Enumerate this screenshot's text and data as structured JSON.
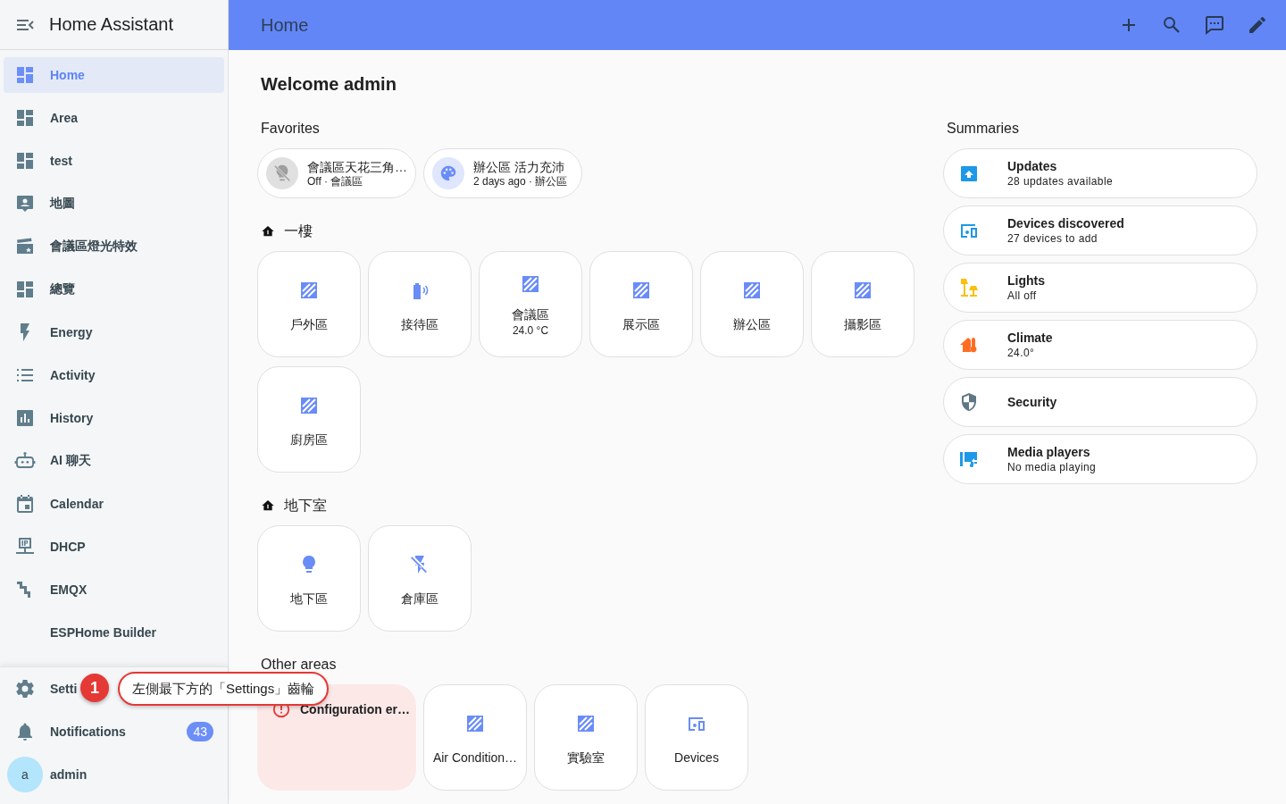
{
  "sidebar": {
    "title": "Home Assistant",
    "items": [
      {
        "label": "Home",
        "selected": true
      },
      {
        "label": "Area",
        "selected": false
      },
      {
        "label": "test",
        "selected": false
      },
      {
        "label": "地圖",
        "selected": false
      },
      {
        "label": "會議區燈光特效",
        "selected": false
      },
      {
        "label": "總覽",
        "selected": false
      },
      {
        "label": "Energy",
        "selected": false
      },
      {
        "label": "Activity",
        "selected": false
      },
      {
        "label": "History",
        "selected": false
      },
      {
        "label": "AI 聊天",
        "selected": false
      },
      {
        "label": "Calendar",
        "selected": false
      },
      {
        "label": "DHCP",
        "selected": false
      },
      {
        "label": "EMQX",
        "selected": false
      },
      {
        "label": "ESPHome Builder",
        "selected": false
      }
    ],
    "footer": [
      {
        "label": "Setti"
      },
      {
        "label": "Notifications",
        "badge": "43"
      }
    ],
    "user": {
      "initial": "a",
      "name": "admin"
    }
  },
  "header": {
    "title": "Home"
  },
  "welcome": "Welcome admin",
  "favorites": {
    "title": "Favorites",
    "items": [
      {
        "name": "會議區天花三角…",
        "state": "Off · 會議區",
        "on": false
      },
      {
        "name": "辦公區 活力充沛",
        "state": "2 days ago · 辦公區",
        "on": true
      }
    ]
  },
  "floors": [
    {
      "name": "一樓",
      "areas": [
        {
          "name": "戶外區"
        },
        {
          "name": "接待區"
        },
        {
          "name": "會議區",
          "reading": "24.0 °C"
        },
        {
          "name": "展示區"
        },
        {
          "name": "辦公區"
        },
        {
          "name": "攝影區"
        },
        {
          "name": "廚房區"
        }
      ]
    },
    {
      "name": "地下室",
      "areas": [
        {
          "name": "地下區"
        },
        {
          "name": "倉庫區"
        }
      ]
    }
  ],
  "other_areas": {
    "title": "Other areas",
    "items": [
      {
        "kind": "error",
        "name": "Configuration er…"
      },
      {
        "kind": "area",
        "name": "Air Condition…"
      },
      {
        "kind": "area",
        "name": "實驗室"
      },
      {
        "kind": "area",
        "name": "Devices"
      }
    ]
  },
  "summaries": {
    "title": "Summaries",
    "items": [
      {
        "name": "Updates",
        "detail": "28 updates available"
      },
      {
        "name": "Devices discovered",
        "detail": "27 devices to add"
      },
      {
        "name": "Lights",
        "detail": "All off"
      },
      {
        "name": "Climate",
        "detail": "24.0°"
      },
      {
        "name": "Security"
      },
      {
        "name": "Media players",
        "detail": "No media playing"
      }
    ]
  },
  "annotation": {
    "number": "1",
    "text": "左側最下方的「Settings」齒輪"
  }
}
